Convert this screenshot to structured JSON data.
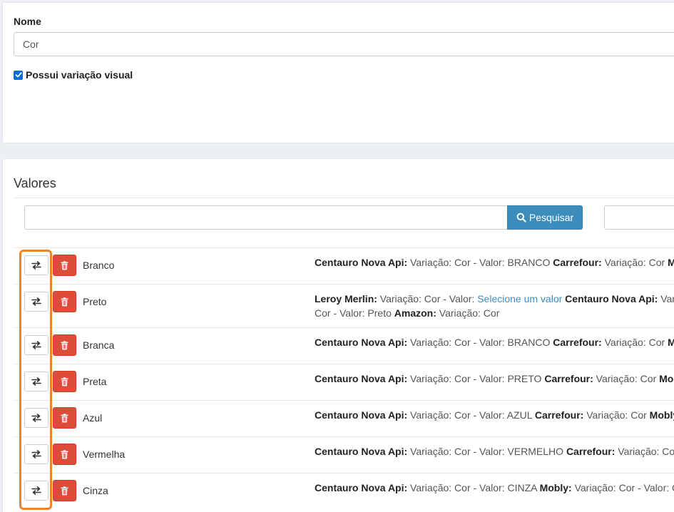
{
  "form": {
    "name_label": "Nome",
    "name_value": "Cor",
    "visual_variation_label": "Possui variação visual",
    "visual_variation_checked": true
  },
  "values_section": {
    "title": "Valores",
    "search_placeholder": "",
    "search_button_label": "Pesquisar",
    "filter_placeholder": ""
  },
  "rows": [
    {
      "name": "Branco",
      "lines": [
        [
          {
            "t": "Centauro Nova Api:",
            "s": "b"
          },
          {
            "t": " Variação: Cor - Valor: BRANCO "
          },
          {
            "t": "Carrefour:",
            "s": "b"
          },
          {
            "t": " Variação: Cor "
          },
          {
            "t": "M",
            "s": "b"
          }
        ]
      ]
    },
    {
      "name": "Preto",
      "lines": [
        [
          {
            "t": "Leroy Merlin:",
            "s": "b"
          },
          {
            "t": " Variação: Cor - Valor: "
          },
          {
            "t": "Selecione um valor",
            "s": "link"
          },
          {
            "t": " "
          },
          {
            "t": "Centauro Nova Api:",
            "s": "b"
          },
          {
            "t": " Var"
          }
        ],
        [
          {
            "t": "Cor - Valor: Preto "
          },
          {
            "t": "Amazon:",
            "s": "b"
          },
          {
            "t": " Variação: Cor"
          }
        ]
      ]
    },
    {
      "name": "Branca",
      "lines": [
        [
          {
            "t": "Centauro Nova Api:",
            "s": "b"
          },
          {
            "t": " Variação: Cor - Valor: BRANCO "
          },
          {
            "t": "Carrefour:",
            "s": "b"
          },
          {
            "t": " Variação: Cor "
          },
          {
            "t": "M",
            "s": "b"
          }
        ]
      ]
    },
    {
      "name": "Preta",
      "lines": [
        [
          {
            "t": "Centauro Nova Api:",
            "s": "b"
          },
          {
            "t": " Variação: Cor - Valor: PRETO "
          },
          {
            "t": "Carrefour:",
            "s": "b"
          },
          {
            "t": " Variação: Cor "
          },
          {
            "t": "Mobl",
            "s": "b"
          }
        ]
      ]
    },
    {
      "name": "Azul",
      "lines": [
        [
          {
            "t": "Centauro Nova Api:",
            "s": "b"
          },
          {
            "t": " Variação: Cor - Valor: AZUL "
          },
          {
            "t": "Carrefour:",
            "s": "b"
          },
          {
            "t": " Variação: Cor "
          },
          {
            "t": "Mobly",
            "s": "b"
          }
        ]
      ]
    },
    {
      "name": "Vermelha",
      "lines": [
        [
          {
            "t": "Centauro Nova Api:",
            "s": "b"
          },
          {
            "t": " Variação: Cor - Valor: VERMELHO "
          },
          {
            "t": "Carrefour:",
            "s": "b"
          },
          {
            "t": " Variação: Co"
          }
        ]
      ]
    },
    {
      "name": "Cinza",
      "lines": [
        [
          {
            "t": "Centauro Nova Api:",
            "s": "b"
          },
          {
            "t": " Variação: Cor - Valor: CINZA "
          },
          {
            "t": "Mobly:",
            "s": "b"
          },
          {
            "t": " Variação: Cor - Valor: C"
          }
        ]
      ]
    }
  ],
  "icons": {
    "map": "exchange-arrows-icon",
    "delete": "trash-icon",
    "search": "search-icon",
    "check": "check-icon"
  },
  "colors": {
    "primary": "#3c8dbc",
    "danger": "#dd4b39",
    "highlight": "#f5821f",
    "checkbox": "#0a6cd6"
  }
}
